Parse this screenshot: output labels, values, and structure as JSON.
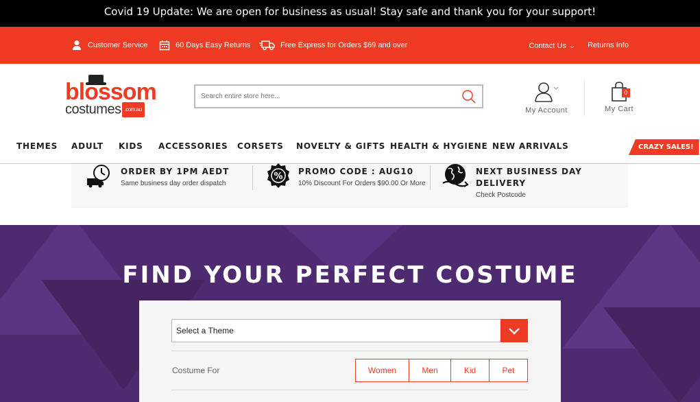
{
  "announcement": "Covid 19 Update: We are open for business as usual! Stay safe and thank you for your support!",
  "topbar": {
    "customer_service": "Customer Service",
    "returns": "60 Days Easy Returns",
    "shipping": "Free Express for Orders $69 and over",
    "contact": "Contact Us",
    "returns_info": "Returns Info"
  },
  "logo": {
    "line1": "blossom",
    "line2": "costumes",
    "domain": ".com.au"
  },
  "search": {
    "placeholder": "Search entire store here..."
  },
  "account": {
    "label": "My Account"
  },
  "cart": {
    "label": "My Cart",
    "count": "0"
  },
  "nav": [
    "THEMES",
    "ADULT",
    "KIDS",
    "ACCESSORIES",
    "CORSETS",
    "NOVELTY & GIFTS",
    "HEALTH & HYGIENE",
    "NEW ARRIVALS"
  ],
  "crazy_sales": "CRAZY SALES!",
  "usp": [
    {
      "title": "ORDER BY 1PM AEDT",
      "sub": "Same business day order dispatch",
      "icon": "clock-truck-icon"
    },
    {
      "title": "PROMO CODE : AUG10",
      "sub": "10% Discount For Orders $90.00 Or More",
      "icon": "percent-badge-icon"
    },
    {
      "title": "NEXT BUSINESS DAY",
      "title2": "DELIVERY",
      "sub": "Check Postcode",
      "icon": "globe-delivery-icon"
    }
  ],
  "finder": {
    "heading": "FIND YOUR PERFECT COSTUME",
    "theme_select": "Select a Theme",
    "costume_for_label": "Costume For",
    "options": [
      "Women",
      "Men",
      "Kid",
      "Pet"
    ]
  },
  "colors": {
    "brand": "#ef3b24",
    "hero": "#4e2a70"
  }
}
